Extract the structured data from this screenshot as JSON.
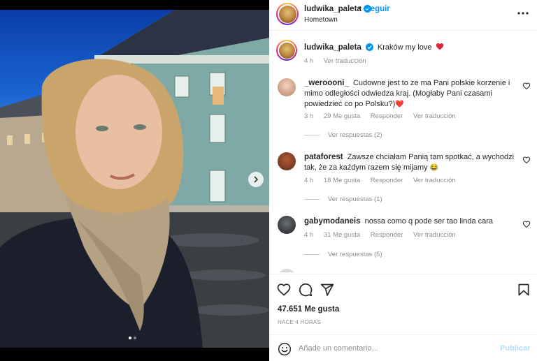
{
  "post": {
    "author": "ludwika_paleta",
    "follow_label": "Seguir",
    "separator": "•",
    "location": "Hometown",
    "caption_user": "ludwika_paleta",
    "caption_text": "Kraków my love",
    "caption_time": "4 h",
    "translate_label": "Ver traducción",
    "carousel_dots": 2,
    "carousel_active": 1
  },
  "comments": [
    {
      "user": "_weroooni_",
      "text": "Cudowne jest to ze ma Pani polskie korzenie i mimo odległości odwiedza kraj. (Mogłaby Pani czasami powiedzieć co po Polsku?)",
      "emoji": "❤️",
      "time": "3 h",
      "likes": "29 Me gusta",
      "reply": "Responder",
      "translate": "Ver traducción",
      "view_replies": "Ver respuestas (2)"
    },
    {
      "user": "pataforest",
      "text": "Zawsze chciałam Panią tam spotkać, a wychodzi tak, że za każdym razem się mijamy",
      "emoji": "😂",
      "time": "4 h",
      "likes": "18 Me gusta",
      "reply": "Responder",
      "translate": "Ver traducción",
      "view_replies": "Ver respuestas (1)"
    },
    {
      "user": "gabymodaneis",
      "text": "nossa como q pode ser tao linda cara",
      "emoji": "",
      "time": "4 h",
      "likes": "31 Me gusta",
      "reply": "Responder",
      "translate": "Ver traducción",
      "view_replies": "Ver respuestas (5)"
    }
  ],
  "stats": {
    "likes": "47.651 Me gusta",
    "time_ago": "HACE 4 HORAS"
  },
  "composer": {
    "placeholder": "Añade un comentario...",
    "publish_label": "Publicar"
  },
  "colors": {
    "accent": "#0095f6",
    "verified": "#0095f6",
    "heart_red": "#ed4956",
    "muted": "#8e8e8e",
    "publish_disabled": "#b2dffc"
  },
  "icons": {
    "like": "heart-icon",
    "comment": "comment-icon",
    "share": "send-icon",
    "save": "bookmark-icon",
    "more": "more-dots-icon",
    "emoji": "emoji-icon",
    "next": "chevron-right-icon",
    "verified": "verified-badge-icon"
  }
}
